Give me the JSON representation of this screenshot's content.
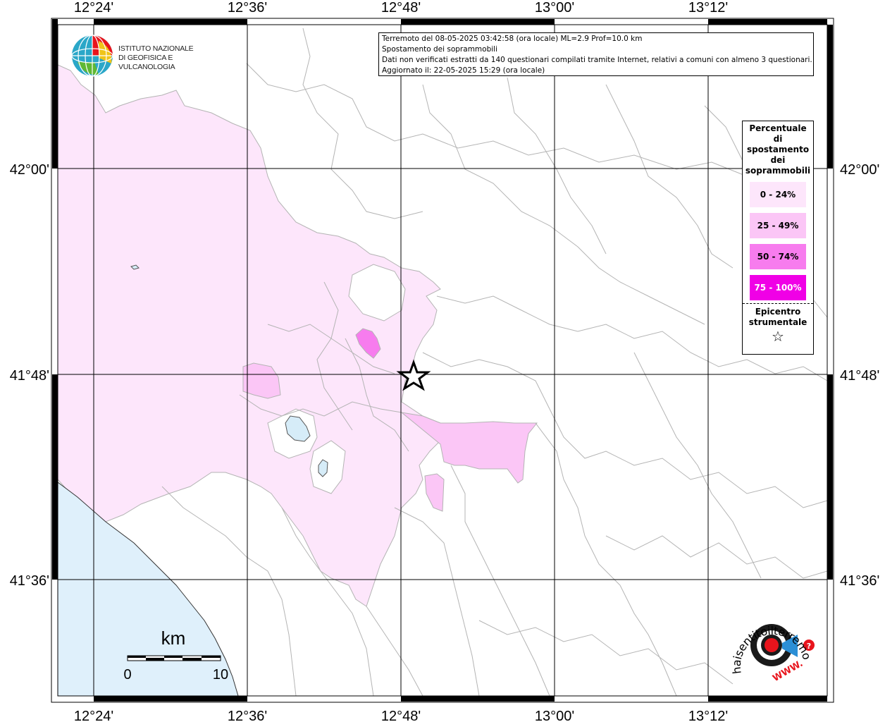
{
  "header": {
    "line1": "Terremoto del 08-05-2025 03:42:58 (ora locale) ML=2.9 Prof=10.0 km",
    "line2": "Spostamento dei soprammobili",
    "line3": "Dati non verificati estratti da 140 questionari compilati tramite Internet, relativi a comuni con almeno 3 questionari.",
    "line4": "Aggiornato il: 22-05-2025 15:29 (ora locale)"
  },
  "logo": {
    "line1": "ISTITUTO NAZIONALE",
    "line2": "DI GEOFISICA E VULCANOLOGIA"
  },
  "legend": {
    "title": "Percentuale\ndi\nspostamento\ndei\nsoprammobili",
    "classes": [
      {
        "label": "0 - 24%",
        "color": "#fde6fb"
      },
      {
        "label": "25 - 49%",
        "color": "#fbc6f6"
      },
      {
        "label": "50 - 74%",
        "color": "#f77cee"
      },
      {
        "label": "75 - 100%",
        "color": "#f000e6"
      }
    ],
    "epicenter_label": "Epicentro\nstrumentale",
    "epicenter_symbol": "☆"
  },
  "axes": {
    "lon_labels": [
      "12°24'",
      "12°36'",
      "12°48'",
      "13°00'",
      "13°12'"
    ],
    "lat_labels": [
      "42°00'",
      "41°48'",
      "41°36'"
    ]
  },
  "scalebar": {
    "unit": "km",
    "min_label": "0",
    "max_label": "10"
  },
  "watermark": {
    "text": "haisentitoilterremoto.it",
    "url": "WWW."
  },
  "colors": {
    "sea": "#dff0fb",
    "lake": "#d6ecf8",
    "class1": "#fde6fb",
    "class2": "#fbc6f6",
    "class3": "#f77cee",
    "class4": "#f000e6",
    "border": "#b4b4b4"
  }
}
